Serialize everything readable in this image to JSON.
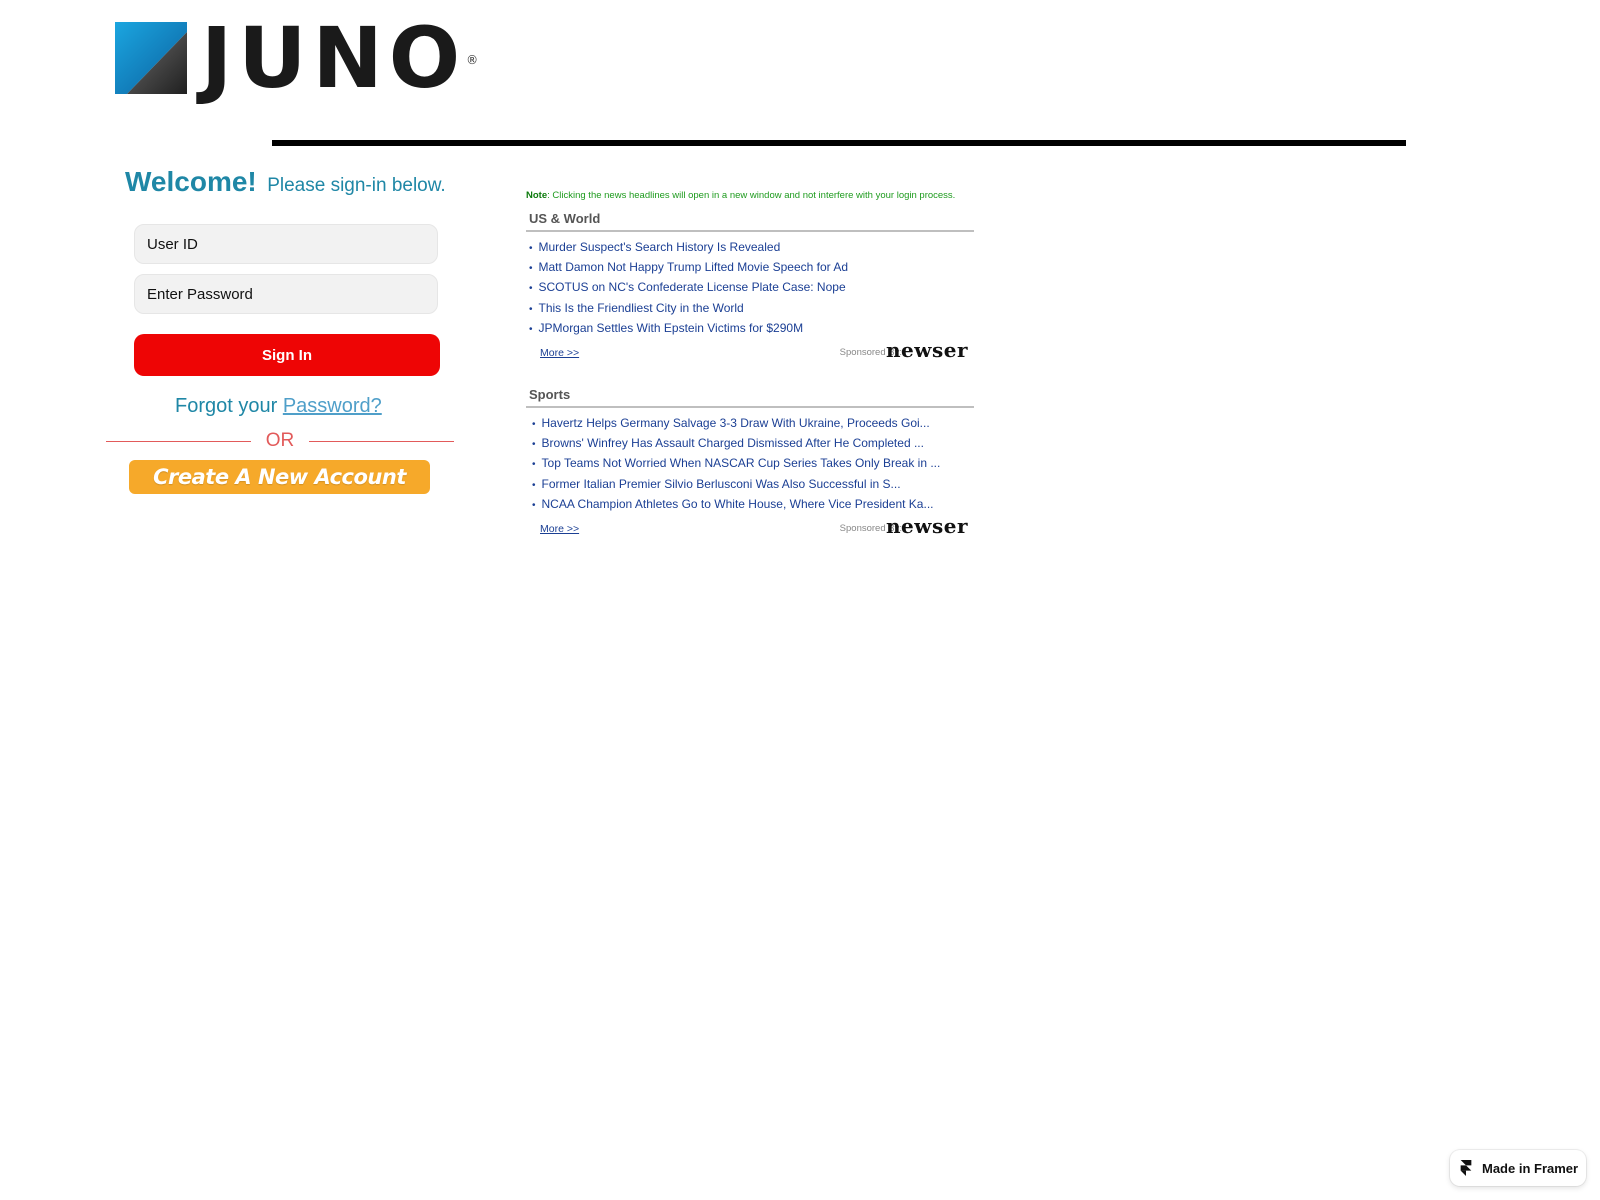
{
  "logo": {
    "text": "JUNO",
    "registered": "®"
  },
  "login": {
    "welcome_big": "Welcome!",
    "welcome_small": "Please sign-in below.",
    "user_placeholder": "User ID",
    "password_placeholder": "Enter Password",
    "signin_label": "Sign In",
    "forgot_prefix": "Forgot your ",
    "forgot_link": "Password?",
    "or_text": "OR",
    "create_label": "Create A New Account"
  },
  "news": {
    "note_label": "Note",
    "note_text": ": Clicking the news headlines will open in a new window and not interfere with your login process.",
    "sponsored_label": "Sponsored By:",
    "sponsor_name": "newser",
    "more_label": "More >>",
    "sections": [
      {
        "title": "US & World",
        "items": [
          "Murder Suspect's Search History Is Revealed",
          "Matt Damon Not Happy Trump Lifted Movie Speech for Ad",
          "SCOTUS on NC's Confederate License Plate Case: Nope",
          "This Is the Friendliest City in the World",
          "JPMorgan Settles With Epstein Victims for $290M"
        ]
      },
      {
        "title": "Sports",
        "items": [
          "Havertz Helps Germany Salvage 3-3 Draw With Ukraine, Proceeds Goi...",
          "Browns' Winfrey Has Assault Charged Dismissed After He Completed ...",
          "Top Teams Not Worried When NASCAR Cup Series Takes Only Break in ...",
          "Former Italian Premier Silvio Berlusconi Was Also Successful in S...",
          "NCAA Champion Athletes Go to White House, Where Vice President Ka..."
        ]
      }
    ]
  },
  "badge": {
    "label": "Made in Framer"
  },
  "colors": {
    "welcome": "#1f87a6",
    "signin": "#ee0505",
    "create": "#f6a92a",
    "news_link": "#1b3f94",
    "note": "#1e9b1e",
    "or": "#e25a5a"
  },
  "icons": [
    "juno-logo-mark-icon",
    "bullet-icon",
    "framer-icon"
  ]
}
